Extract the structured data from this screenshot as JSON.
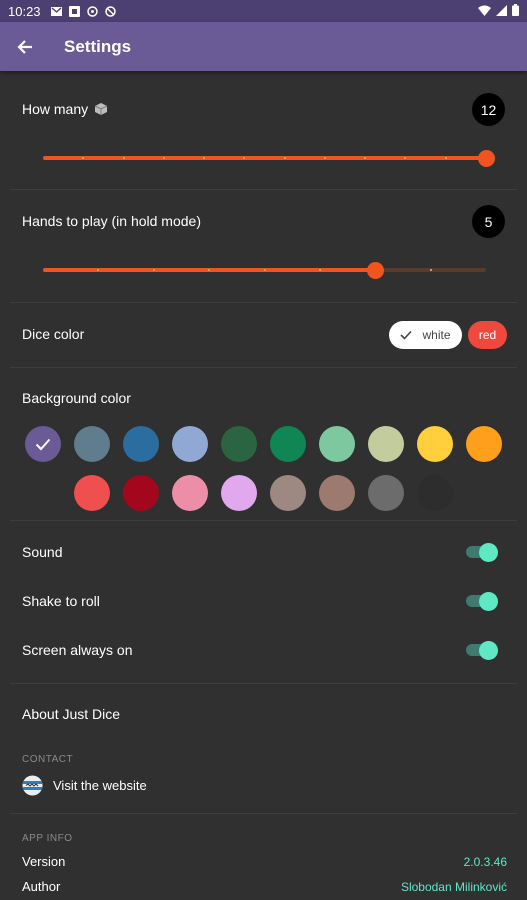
{
  "status_bar": {
    "time": "10:23"
  },
  "app_bar": {
    "title": "Settings"
  },
  "how_many": {
    "label": "How many",
    "value": "12",
    "level": 1.0,
    "steps": 11
  },
  "hands": {
    "label": "Hands to play (in hold mode)",
    "value": "5",
    "level": 0.75,
    "steps": 8
  },
  "dice_color": {
    "label": "Dice color",
    "options": [
      "white",
      "red"
    ],
    "selected": "white"
  },
  "background": {
    "label": "Background color",
    "selected_index": 0,
    "colors": [
      "#6a5a95",
      "#5f7d8c",
      "#2c6da0",
      "#8fa9d4",
      "#2a6440",
      "#0f8654",
      "#7ec8a0",
      "#c2cc9c",
      "#ffcf3e",
      "#ff9f1c",
      "#ef4f4f",
      "#a3071e",
      "#ed8ea8",
      "#e2a8ee",
      "#9d8882",
      "#9c7a6f",
      "#6c6c6c",
      "#2d2d2d"
    ]
  },
  "toggles": [
    {
      "label": "Sound",
      "on": true
    },
    {
      "label": "Shake to roll",
      "on": true
    },
    {
      "label": "Screen always on",
      "on": true
    }
  ],
  "about": {
    "label": "About Just Dice"
  },
  "contact": {
    "heading": "CONTACT",
    "link": "Visit the website"
  },
  "app_info": {
    "heading": "APP INFO",
    "version_label": "Version",
    "version": "2.0.3.46",
    "author_label": "Author",
    "author": "Slobodan Milinković"
  }
}
